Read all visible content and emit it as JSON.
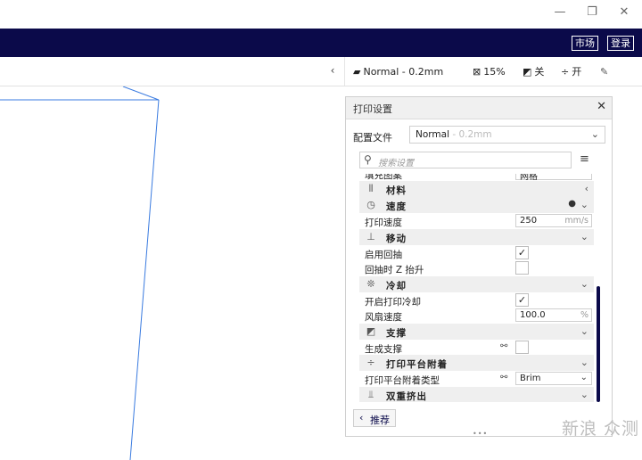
{
  "window": {
    "minimize": "—",
    "restore": "❐",
    "close": "✕"
  },
  "topbar": {
    "market_label": "市场",
    "login_label": "登录"
  },
  "toolbar": {
    "collapse_arrow": "‹",
    "profile_icon": "▰",
    "profile_label": "Normal - 0.2mm",
    "infill_icon": "⊠",
    "infill_value": "15%",
    "support_icon": "◩",
    "support_value": "关",
    "adhesion_icon": "÷",
    "adhesion_value": "开",
    "edit_icon": "✎"
  },
  "panel": {
    "title": "打印设置",
    "close": "✕",
    "profile_label": "配置文件",
    "profile_value": "Normal",
    "profile_sub": " - 0.2mm",
    "profile_chevron": "⌄",
    "search_icon": "⚲",
    "search_placeholder": "搜索设置",
    "menu_icon": "≡",
    "recommend_arrow": "‹",
    "recommend_label": "推荐",
    "grip": "•••"
  },
  "settings": {
    "partial": {
      "label": "填充图案",
      "value": "网格"
    },
    "cat_material": {
      "icon": "⦀",
      "label": "材料",
      "arrow": "‹"
    },
    "cat_speed": {
      "icon": "◷",
      "label": "速度",
      "info": "●",
      "arrow": "⌄"
    },
    "print_speed": {
      "label": "打印速度",
      "value": "250",
      "unit": "mm/s"
    },
    "cat_travel": {
      "icon": "⊥",
      "label": "移动",
      "arrow": "⌄"
    },
    "retraction": {
      "label": "启用回抽",
      "check": "✓"
    },
    "z_hop": {
      "label": "回抽时 Z 抬升",
      "check": ""
    },
    "cat_cooling": {
      "icon": "❊",
      "label": "冷却",
      "arrow": "⌄"
    },
    "fan_enable": {
      "label": "开启打印冷却",
      "check": "✓"
    },
    "fan_speed": {
      "label": "风扇速度",
      "value": "100.0",
      "unit": "%"
    },
    "cat_support": {
      "icon": "◩",
      "label": "支撑",
      "arrow": "⌄"
    },
    "gen_support": {
      "label": "生成支撑",
      "link": "⚯",
      "check": ""
    },
    "cat_adhesion": {
      "icon": "÷",
      "label": "打印平台附着",
      "arrow": "⌄"
    },
    "adhesion_type": {
      "label": "打印平台附着类型",
      "link": "⚯",
      "value": "Brim",
      "chevron": "⌄"
    },
    "cat_dual": {
      "icon": "⫫",
      "label": "双重挤出",
      "arrow": "⌄"
    }
  },
  "watermark": "新浪 众测"
}
